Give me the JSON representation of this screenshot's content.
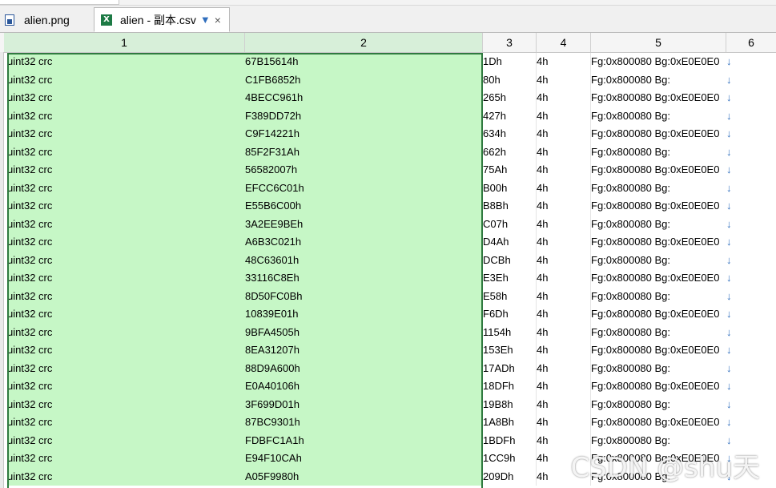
{
  "tabs": [
    {
      "label": "alien.png",
      "icon": "png-file-icon"
    },
    {
      "label": "alien - 副本.csv",
      "icon": "excel-file-icon",
      "filter_icon": "filter-icon",
      "close": "×"
    }
  ],
  "columns": [
    "1",
    "2",
    "3",
    "4",
    "5",
    "6"
  ],
  "rows": [
    {
      "c1": "uint32 crc",
      "c2": "67B15614h",
      "c3": "1Dh",
      "c4": "4h",
      "c5": "Fg:0x800080 Bg:0xE0E0E0",
      "c6": "↓"
    },
    {
      "c1": "uint32 crc",
      "c2": "C1FB6852h",
      "c3": "80h",
      "c4": "4h",
      "c5": "Fg:0x800080 Bg:",
      "c6": "↓"
    },
    {
      "c1": "uint32 crc",
      "c2": "4BECC961h",
      "c3": "265h",
      "c4": "4h",
      "c5": "Fg:0x800080 Bg:0xE0E0E0",
      "c6": "↓"
    },
    {
      "c1": "uint32 crc",
      "c2": "F389DD72h",
      "c3": "427h",
      "c4": "4h",
      "c5": "Fg:0x800080 Bg:",
      "c6": "↓"
    },
    {
      "c1": "uint32 crc",
      "c2": "C9F14221h",
      "c3": "634h",
      "c4": "4h",
      "c5": "Fg:0x800080 Bg:0xE0E0E0",
      "c6": "↓"
    },
    {
      "c1": "uint32 crc",
      "c2": "85F2F31Ah",
      "c3": "662h",
      "c4": "4h",
      "c5": "Fg:0x800080 Bg:",
      "c6": "↓"
    },
    {
      "c1": "uint32 crc",
      "c2": "56582007h",
      "c3": "75Ah",
      "c4": "4h",
      "c5": "Fg:0x800080 Bg:0xE0E0E0",
      "c6": "↓"
    },
    {
      "c1": "uint32 crc",
      "c2": "EFCC6C01h",
      "c3": "B00h",
      "c4": "4h",
      "c5": "Fg:0x800080 Bg:",
      "c6": "↓"
    },
    {
      "c1": "uint32 crc",
      "c2": "E55B6C00h",
      "c3": "B8Bh",
      "c4": "4h",
      "c5": "Fg:0x800080 Bg:0xE0E0E0",
      "c6": "↓"
    },
    {
      "c1": "uint32 crc",
      "c2": "3A2EE9BEh",
      "c3": "C07h",
      "c4": "4h",
      "c5": "Fg:0x800080 Bg:",
      "c6": "↓"
    },
    {
      "c1": "uint32 crc",
      "c2": "A6B3C021h",
      "c3": "D4Ah",
      "c4": "4h",
      "c5": "Fg:0x800080 Bg:0xE0E0E0",
      "c6": "↓"
    },
    {
      "c1": "uint32 crc",
      "c2": "48C63601h",
      "c3": "DCBh",
      "c4": "4h",
      "c5": "Fg:0x800080 Bg:",
      "c6": "↓"
    },
    {
      "c1": "uint32 crc",
      "c2": "33116C8Eh",
      "c3": "E3Eh",
      "c4": "4h",
      "c5": "Fg:0x800080 Bg:0xE0E0E0",
      "c6": "↓"
    },
    {
      "c1": "uint32 crc",
      "c2": "8D50FC0Bh",
      "c3": "E58h",
      "c4": "4h",
      "c5": "Fg:0x800080 Bg:",
      "c6": "↓"
    },
    {
      "c1": "uint32 crc",
      "c2": "10839E01h",
      "c3": "F6Dh",
      "c4": "4h",
      "c5": "Fg:0x800080 Bg:0xE0E0E0",
      "c6": "↓"
    },
    {
      "c1": "uint32 crc",
      "c2": "9BFA4505h",
      "c3": "1154h",
      "c4": "4h",
      "c5": "Fg:0x800080 Bg:",
      "c6": "↓"
    },
    {
      "c1": "uint32 crc",
      "c2": "8EA31207h",
      "c3": "153Eh",
      "c4": "4h",
      "c5": "Fg:0x800080 Bg:0xE0E0E0",
      "c6": "↓"
    },
    {
      "c1": "uint32 crc",
      "c2": "88D9A600h",
      "c3": "17ADh",
      "c4": "4h",
      "c5": "Fg:0x800080 Bg:",
      "c6": "↓"
    },
    {
      "c1": "uint32 crc",
      "c2": "E0A40106h",
      "c3": "18DFh",
      "c4": "4h",
      "c5": "Fg:0x800080 Bg:0xE0E0E0",
      "c6": "↓"
    },
    {
      "c1": "uint32 crc",
      "c2": "3F699D01h",
      "c3": "19B8h",
      "c4": "4h",
      "c5": "Fg:0x800080 Bg:",
      "c6": "↓"
    },
    {
      "c1": "uint32 crc",
      "c2": "87BC9301h",
      "c3": "1A8Bh",
      "c4": "4h",
      "c5": "Fg:0x800080 Bg:0xE0E0E0",
      "c6": "↓"
    },
    {
      "c1": "uint32 crc",
      "c2": "FDBFC1A1h",
      "c3": "1BDFh",
      "c4": "4h",
      "c5": "Fg:0x800080 Bg:",
      "c6": "↓"
    },
    {
      "c1": "uint32 crc",
      "c2": "E94F10CAh",
      "c3": "1CC9h",
      "c4": "4h",
      "c5": "Fg:0x800080 Bg:0xE0E0E0",
      "c6": "↓"
    },
    {
      "c1": "uint32 crc",
      "c2": "A05F9980h",
      "c3": "209Dh",
      "c4": "4h",
      "c5": "Fg:0x800080 Bg:",
      "c6": "↓"
    }
  ],
  "watermark": "CSDN @shu天",
  "colors": {
    "selection": "#c6f7c6",
    "selection_border": "#2f7a3f",
    "arrow": "#2f6ebd"
  }
}
